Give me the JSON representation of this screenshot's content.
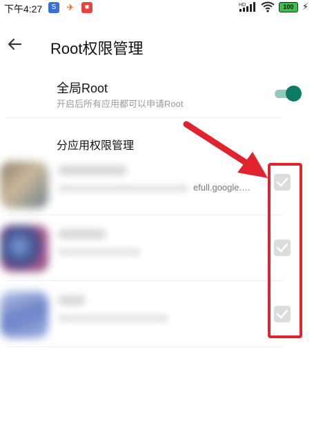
{
  "status": {
    "time": "下午4:27",
    "network_badge": "HD",
    "battery_level": "100",
    "notif_icons": [
      "app-notif-1",
      "app-notif-2",
      "app-notif-3"
    ]
  },
  "header": {
    "title": "Root权限管理",
    "back_icon": "arrow-left-icon"
  },
  "global_root": {
    "title": "全局Root",
    "subtitle": "开启后所有应用都可以申请Root",
    "enabled": true,
    "accent_color": "#0b7b63"
  },
  "section": {
    "title": "分应用权限管理"
  },
  "apps": [
    {
      "package_tail": "efull.google.…",
      "checked": true
    },
    {
      "package_tail": "",
      "checked": true
    },
    {
      "package_tail": "",
      "checked": true
    }
  ],
  "annotation": {
    "color": "#e0232d"
  }
}
